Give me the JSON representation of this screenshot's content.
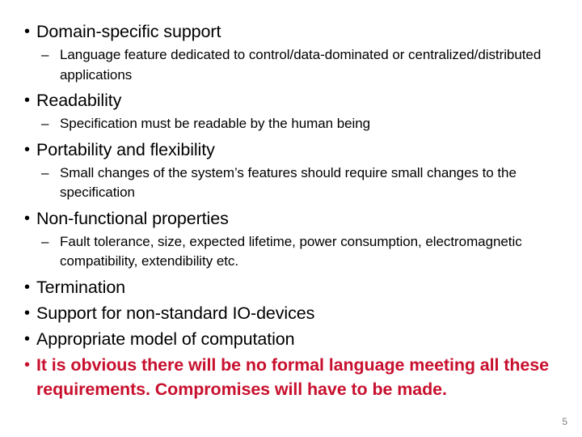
{
  "slide": {
    "page_number": "5",
    "background_color": "#ffffff",
    "default_text_color": "#000000",
    "emphasis_color": "#C8102E",
    "page_number_color": "#808080",
    "bullet_glyph": "•",
    "dash_glyph": "–",
    "bullets": [
      {
        "level": 1,
        "text": "Domain-specific support",
        "emphasis": false
      },
      {
        "level": 2,
        "text": "Language feature dedicated to control/data-dominated or centralized/distributed applications",
        "emphasis": false
      },
      {
        "level": 1,
        "text": "Readability",
        "emphasis": false
      },
      {
        "level": 2,
        "text": "Specification must be readable by the human being",
        "emphasis": false
      },
      {
        "level": 1,
        "text": "Portability and flexibility",
        "emphasis": false
      },
      {
        "level": 2,
        "text": "Small changes of the system’s features should require small changes to the specification",
        "emphasis": false
      },
      {
        "level": 1,
        "text": "Non-functional properties",
        "emphasis": false
      },
      {
        "level": 2,
        "text": "Fault tolerance, size, expected lifetime, power consumption, electromagnetic compatibility, extendibility etc.",
        "emphasis": false
      },
      {
        "level": 1,
        "text": "Termination",
        "emphasis": false
      },
      {
        "level": 1,
        "text": "Support for non-standard IO-devices",
        "emphasis": false
      },
      {
        "level": 1,
        "text": "Appropriate model of computation",
        "emphasis": false
      },
      {
        "level": 1,
        "text": "It is obvious there will be no formal language meeting all these requirements. Compromises will have to be made.",
        "emphasis": true
      }
    ]
  }
}
